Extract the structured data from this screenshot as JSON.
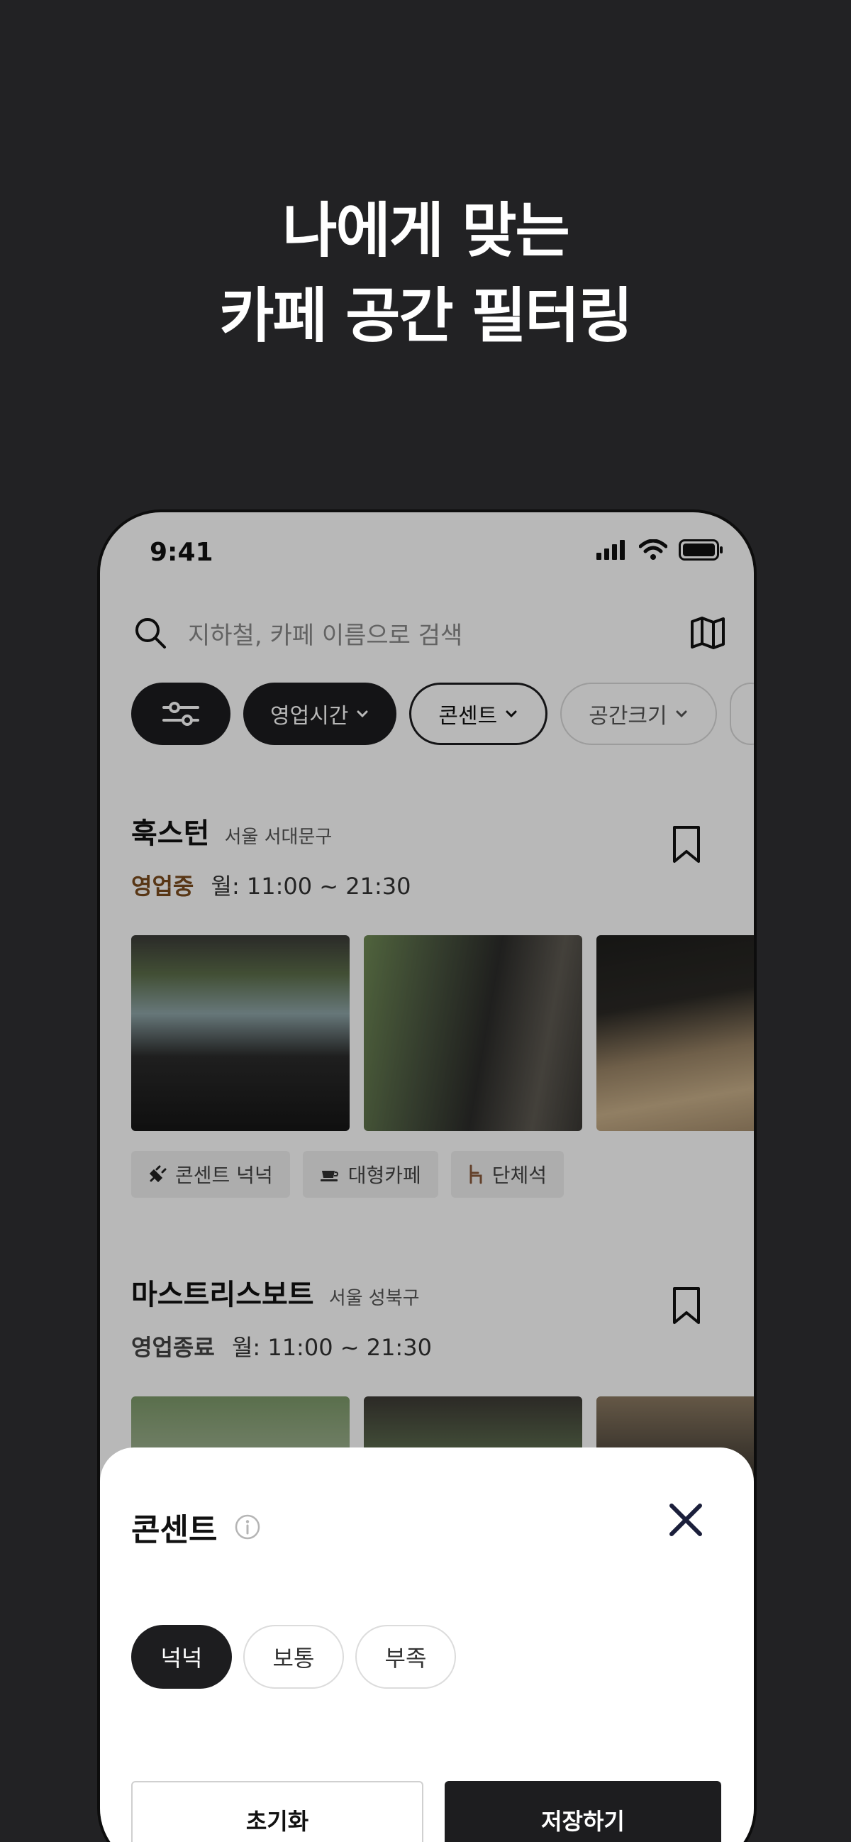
{
  "hero": {
    "line1": "나에게 맞는",
    "line2": "카페 공간 필터링"
  },
  "status": {
    "time": "9:41"
  },
  "search": {
    "placeholder": "지하철, 카페 이름으로 검색"
  },
  "chips": [
    {
      "label": "영업시간"
    },
    {
      "label": "콘센트"
    },
    {
      "label": "공간크기"
    }
  ],
  "cafes": [
    {
      "name": "훅스턴",
      "location": "서울 서대문구",
      "status": "영업중",
      "hours": "월: 11:00 ~ 21:30",
      "tags": [
        "콘센트 넉넉",
        "대형카페",
        "단체석"
      ]
    },
    {
      "name": "마스트리스보트",
      "location": "서울 성북구",
      "status": "영업종료",
      "hours": "월: 11:00 ~ 21:30"
    }
  ],
  "sheet": {
    "title": "콘센트",
    "options": [
      "넉넉",
      "보통",
      "부족"
    ],
    "selected": "넉넉",
    "reset_label": "초기화",
    "save_label": "저장하기"
  }
}
